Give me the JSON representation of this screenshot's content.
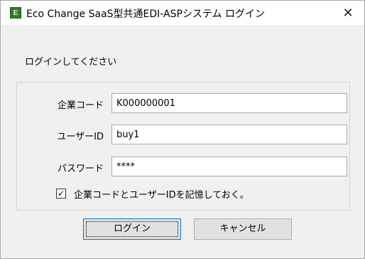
{
  "window": {
    "icon_letter": "E",
    "title": "Eco Change SaaS型共通EDI-ASPシステム ログイン",
    "close_glyph": "✕"
  },
  "form": {
    "prompt": "ログインしてください",
    "company_code": {
      "label": "企業コード",
      "value": "K000000001"
    },
    "user_id": {
      "label": "ユーザーID",
      "value": "buy1"
    },
    "password": {
      "label": "パスワード",
      "value": "****"
    },
    "remember": {
      "label": "企業コードとユーザーIDを記憶しておく。",
      "checked": true,
      "mark": "✓"
    }
  },
  "buttons": {
    "login": "ログイン",
    "cancel": "キャンセル"
  }
}
